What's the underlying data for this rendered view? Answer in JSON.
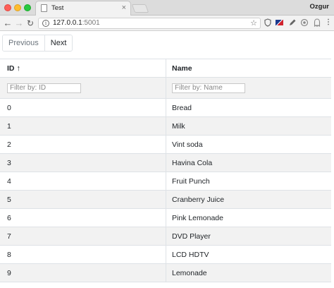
{
  "browser": {
    "tab_title": "Test",
    "tab_close": "×",
    "profile_name": "Ozgur",
    "url_host": "127.0.0.1",
    "url_port": ":5001",
    "nav": {
      "back": "←",
      "forward": "→",
      "reload": "↻"
    },
    "star": "☆",
    "info": "i",
    "extensions": [
      "shield-icon",
      "flag-icon",
      "pen-icon",
      "privacy-icon",
      "ghost-icon",
      "menu-icon"
    ],
    "menu_glyph": "⋮"
  },
  "pager": {
    "previous_label": "Previous",
    "next_label": "Next"
  },
  "table": {
    "columns": [
      {
        "label": "ID",
        "sort": "↑"
      },
      {
        "label": "Name"
      }
    ],
    "filters": {
      "id_placeholder": "Filter by: ID",
      "name_placeholder": "Filter by: Name"
    },
    "rows": [
      {
        "id": "0",
        "name": "Bread"
      },
      {
        "id": "1",
        "name": "Milk"
      },
      {
        "id": "2",
        "name": "Vint soda"
      },
      {
        "id": "3",
        "name": "Havina Cola"
      },
      {
        "id": "4",
        "name": "Fruit Punch"
      },
      {
        "id": "5",
        "name": "Cranberry Juice"
      },
      {
        "id": "6",
        "name": "Pink Lemonade"
      },
      {
        "id": "7",
        "name": "DVD Player"
      },
      {
        "id": "8",
        "name": "LCD HDTV"
      },
      {
        "id": "9",
        "name": "Lemonade"
      }
    ]
  },
  "colors": {
    "stripe": "#f2f2f2",
    "border": "#dee2e6",
    "text": "#212529"
  }
}
